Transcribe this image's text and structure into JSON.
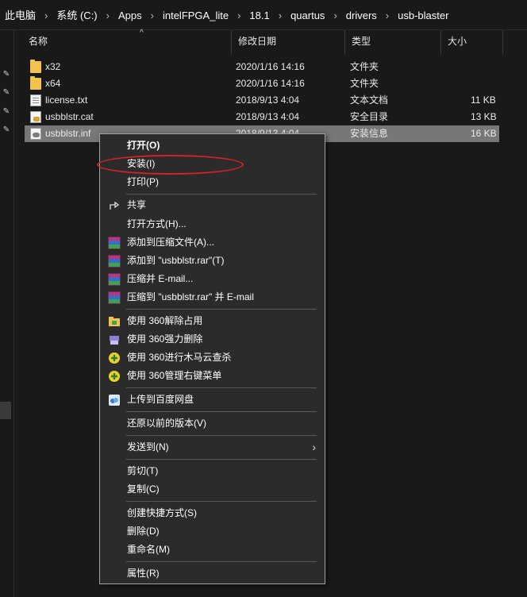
{
  "breadcrumb": [
    "此电脑",
    "系统 (C:)",
    "Apps",
    "intelFPGA_lite",
    "18.1",
    "quartus",
    "drivers",
    "usb-blaster"
  ],
  "columns": [
    "名称",
    "修改日期",
    "类型",
    "大小"
  ],
  "files": [
    {
      "name": "x32",
      "date": "2020/1/16 14:16",
      "type": "文件夹",
      "size": "",
      "icon": "folder-icon"
    },
    {
      "name": "x64",
      "date": "2020/1/16 14:16",
      "type": "文件夹",
      "size": "",
      "icon": "folder-icon"
    },
    {
      "name": "license.txt",
      "date": "2018/9/13 4:04",
      "type": "文本文档",
      "size": "11 KB",
      "icon": "text-file-icon"
    },
    {
      "name": "usbblstr.cat",
      "date": "2018/9/13 4:04",
      "type": "安全目录",
      "size": "13 KB",
      "icon": "security-catalog-icon"
    },
    {
      "name": "usbblstr.inf",
      "date": "2018/9/13 4:04",
      "type": "安装信息",
      "size": "16 KB",
      "icon": "setup-info-icon"
    }
  ],
  "context_menu": {
    "open": "打开(O)",
    "install": "安装(I)",
    "print": "打印(P)",
    "share": "共享",
    "open_with": "打开方式(H)...",
    "add_archive": "添加到压缩文件(A)...",
    "add_rar": "添加到 \"usbblstr.rar\"(T)",
    "compress_email": "压缩并 E-mail...",
    "compress_rar_email": "压缩到 \"usbblstr.rar\" 并 E-mail",
    "unlock_360": "使用 360解除占用",
    "force_delete_360": "使用 360强力删除",
    "trojan_scan_360": "使用 360进行木马云查杀",
    "manage_menu_360": "使用 360管理右键菜单",
    "baidu_upload": "上传到百度网盘",
    "restore_versions": "还原以前的版本(V)",
    "send_to": "发送到(N)",
    "cut": "剪切(T)",
    "copy": "复制(C)",
    "create_shortcut": "创建快捷方式(S)",
    "delete": "删除(D)",
    "rename": "重命名(M)",
    "properties": "属性(R)"
  },
  "colors": {
    "background": "#191919",
    "menu_bg": "#2b2b2b",
    "selection": "#777777",
    "annotation_ring": "#d2222a"
  }
}
